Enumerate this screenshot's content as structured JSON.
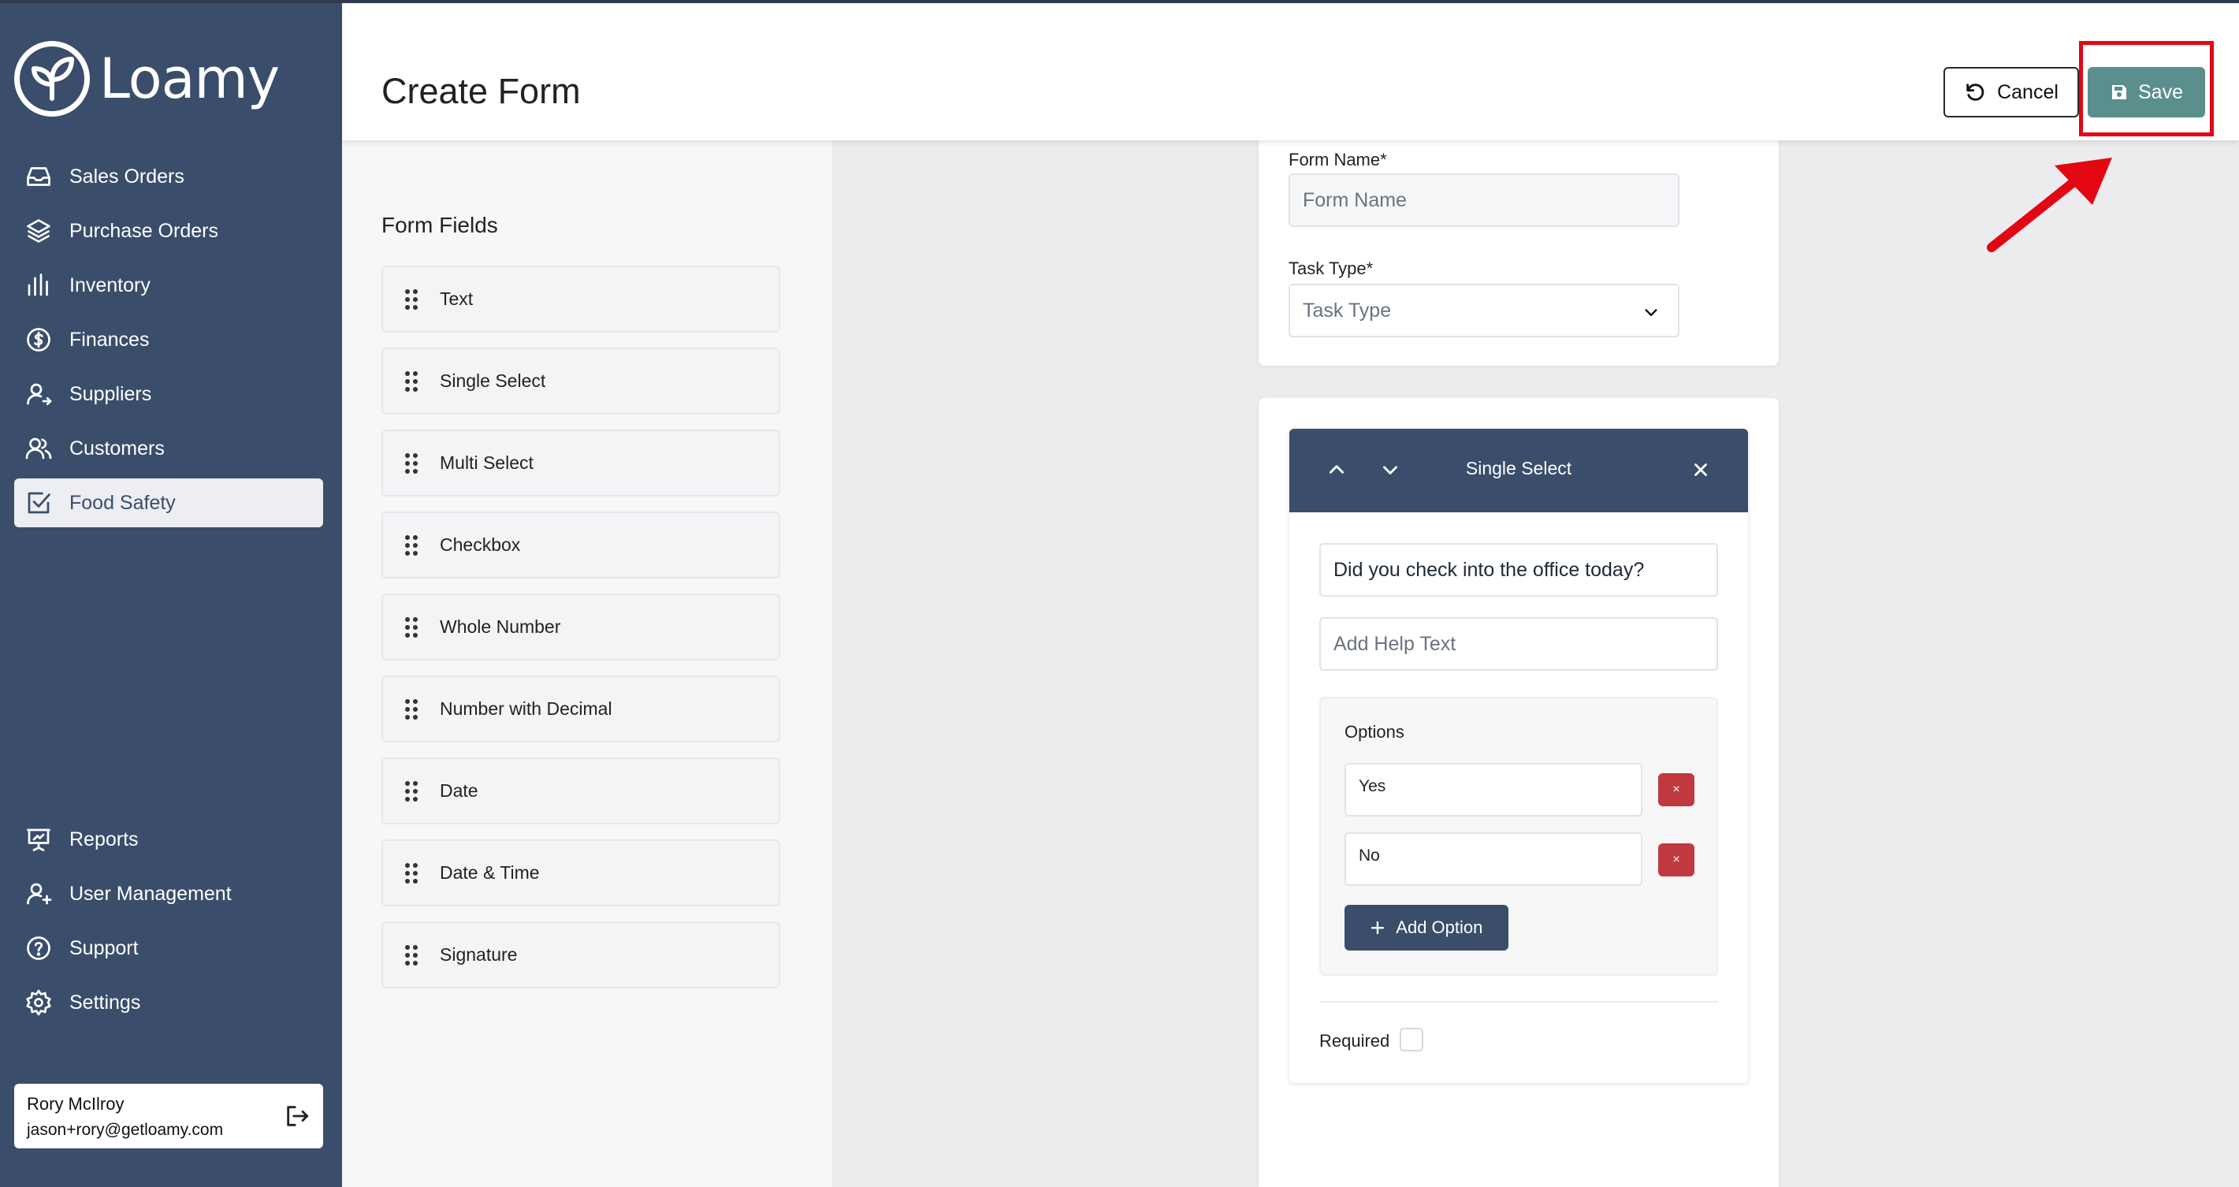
{
  "app": {
    "name": "Loamy"
  },
  "sidebar": {
    "nav": [
      {
        "label": "Sales Orders",
        "icon": "inbox-icon"
      },
      {
        "label": "Purchase Orders",
        "icon": "layers-icon"
      },
      {
        "label": "Inventory",
        "icon": "bars-icon"
      },
      {
        "label": "Finances",
        "icon": "dollar-circle-icon"
      },
      {
        "label": "Suppliers",
        "icon": "user-arrow-icon"
      },
      {
        "label": "Customers",
        "icon": "users-icon"
      },
      {
        "label": "Food Safety",
        "icon": "check-square-icon",
        "active": true
      }
    ],
    "bottom_nav": [
      {
        "label": "Reports",
        "icon": "presentation-icon"
      },
      {
        "label": "User Management",
        "icon": "user-plus-icon"
      },
      {
        "label": "Support",
        "icon": "help-circle-icon"
      },
      {
        "label": "Settings",
        "icon": "gear-icon"
      }
    ],
    "user": {
      "name": "Rory McIlroy",
      "email": "jason+rory@getloamy.com"
    }
  },
  "header": {
    "title": "Create Form",
    "cancel_label": "Cancel",
    "save_label": "Save"
  },
  "form_fields": {
    "title": "Form Fields",
    "items": [
      "Text",
      "Single Select",
      "Multi Select",
      "Checkbox",
      "Whole Number",
      "Number with Decimal",
      "Date",
      "Date & Time",
      "Signature"
    ]
  },
  "form_meta": {
    "name_label": "Form Name*",
    "name_placeholder": "Form Name",
    "task_label": "Task Type*",
    "task_placeholder": "Task Type"
  },
  "field_editor": {
    "type_title": "Single Select",
    "question": "Did you check into the office today?",
    "help_placeholder": "Add Help Text",
    "options_title": "Options",
    "options": [
      "Yes",
      "No"
    ],
    "delete_glyph": "×",
    "add_option_label": "Add Option",
    "required_label": "Required",
    "required_checked": false
  },
  "colors": {
    "sidebar": "#3a4d6b",
    "save": "#5b8f8e",
    "delete": "#c0393e",
    "highlight": "#e30613"
  }
}
